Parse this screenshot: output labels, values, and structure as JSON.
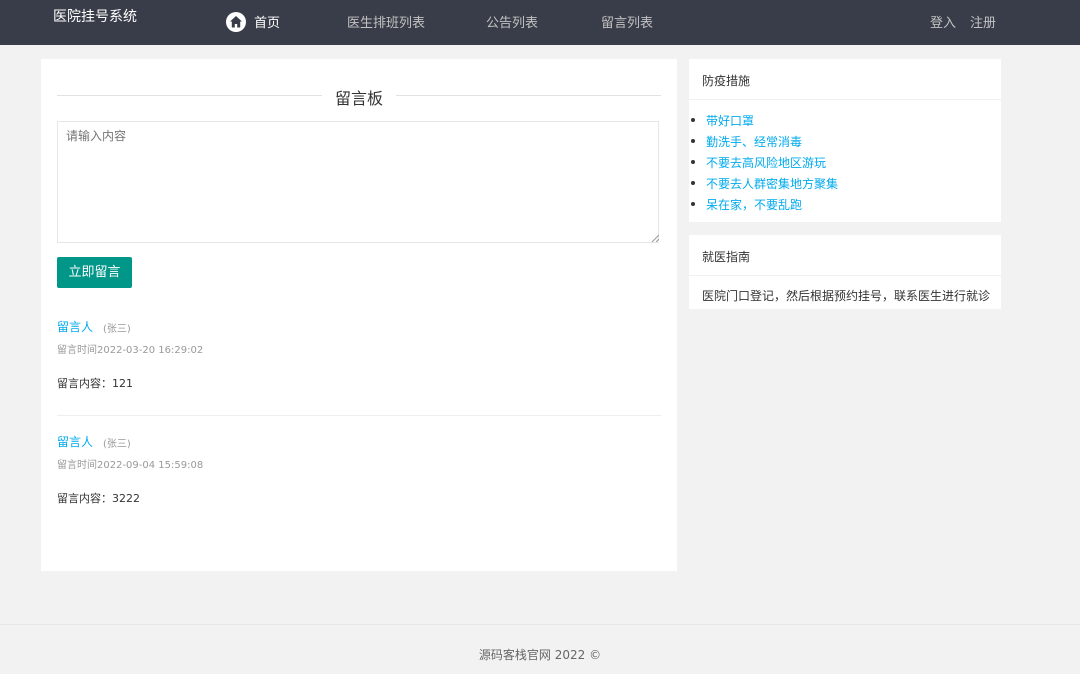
{
  "header": {
    "logo": "医院挂号系统",
    "nav": [
      {
        "label": "首页",
        "icon": "home-icon"
      },
      {
        "label": "医生排班列表"
      },
      {
        "label": "公告列表"
      },
      {
        "label": "留言列表"
      }
    ],
    "auth": {
      "login": "登入",
      "register": "注册"
    }
  },
  "board": {
    "title": "留言板",
    "placeholder": "请输入内容",
    "submit_label": "立即留言",
    "messages": [
      {
        "author_label": "留言人",
        "author_name": "(张三)",
        "time": "留言时间2022-03-20 16:29:02",
        "content": "留言内容：121"
      },
      {
        "author_label": "留言人",
        "author_name": "(张三)",
        "time": "留言时间2022-09-04 15:59:08",
        "content": "留言内容：3222"
      }
    ]
  },
  "sidebar": {
    "prevention": {
      "title": "防疫措施",
      "items": [
        "带好口罩",
        "勤洗手、经常消毒",
        "不要去高风险地区游玩",
        "不要去人群密集地方聚集",
        "呆在家，不要乱跑"
      ]
    },
    "guide": {
      "title": "就医指南",
      "text": "医院门口登记，然后根据预约挂号，联系医生进行就诊"
    }
  },
  "footer": {
    "text": "源码客栈官网  2022 ©"
  },
  "colors": {
    "header_bg": "#393d49",
    "accent": "#009688",
    "link": "#01aaed"
  }
}
